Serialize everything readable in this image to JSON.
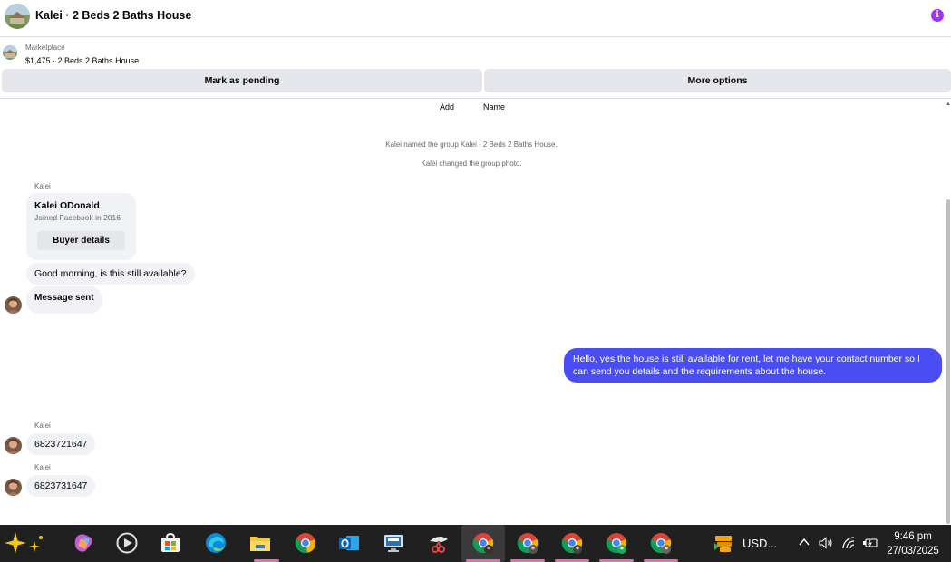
{
  "header": {
    "title": "Kalei · 2 Beds 2 Baths House",
    "info_glyph": "i"
  },
  "listing": {
    "category": "Marketplace",
    "description": "$1,475 · 2 Beds 2 Baths House"
  },
  "actions": {
    "pending_label": "Mark as pending",
    "more_label": "More options"
  },
  "group_links": {
    "add_label": "Add",
    "name_label": "Name"
  },
  "system_messages": [
    "Kalei named the group Kalei · 2 Beds 2 Baths House.",
    "Kalei changed the group photo."
  ],
  "buyer_card": {
    "sender": "Kalei",
    "name": "Kalei ODonald",
    "joined": "Joined Facebook in 2016",
    "button_label": "Buyer details"
  },
  "messages": {
    "m1": "Good morning, is this still available?",
    "m2": "Message sent",
    "m3": "Hello, yes the house is still available for rent, let me have your contact number so I can send you details and the requirements about the house.",
    "m4_sender": "Kalei",
    "m4": "6823721647",
    "m5_sender": "Kalei",
    "m5": "6823731647"
  },
  "taskbar": {
    "currency_label": "USD...",
    "time": "9:46 pm",
    "date": "27/03/2025",
    "icons": [
      "copilot-icon",
      "m365-icon",
      "media-player-icon",
      "store-icon",
      "edge-icon",
      "file-explorer-icon",
      "chrome-icon",
      "outlook-icon",
      "remote-desktop-icon",
      "snipping-tool-icon",
      "chrome-profile-icon"
    ]
  },
  "colors": {
    "accent": "#4a4ef2",
    "info": "#a033ff",
    "bubble": "#f0f2f5",
    "button": "#e4e6eb",
    "taskbar": "#202020"
  }
}
